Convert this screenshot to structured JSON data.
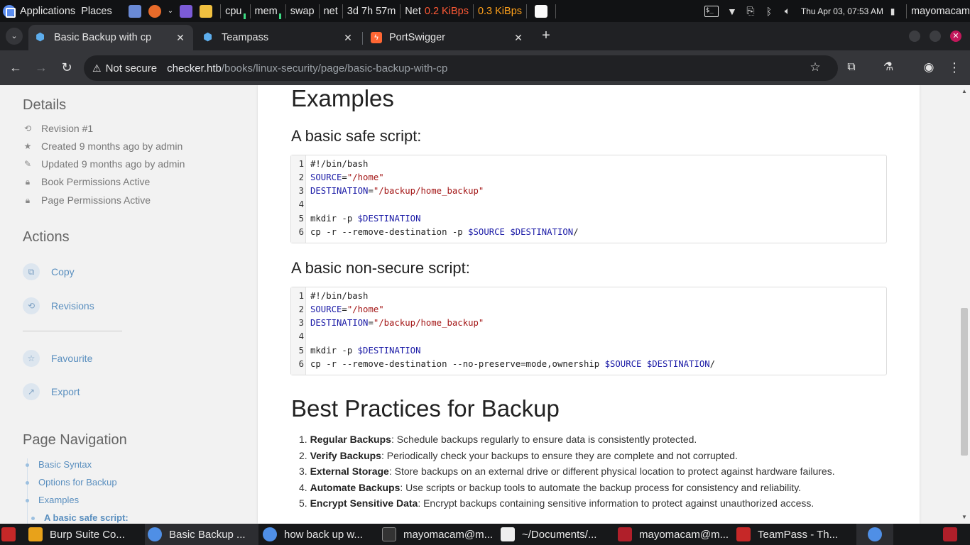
{
  "panel": {
    "applications": "Applications",
    "places": "Places",
    "cpu": "cpu",
    "mem": "mem",
    "swap": "swap",
    "net": "net",
    "uptime": "3d 7h 57m",
    "net_label": "Net",
    "net_down": "0.2 KiBps",
    "net_up": "0.3 KiBps",
    "terminal_icon_text": "$_",
    "datetime": "Thu Apr 03, 07:53 AM",
    "user": "mayomacam"
  },
  "tabs": [
    {
      "title": "Basic Backup with cp",
      "icon": "bookstack-icon"
    },
    {
      "title": "Teampass",
      "icon": "bookstack-icon"
    },
    {
      "title": "PortSwigger",
      "icon": "portswigger-icon"
    }
  ],
  "toolbar": {
    "security": "Not secure",
    "url_host": "checker.htb",
    "url_path": "/books/linux-security/page/basic-backup-with-cp"
  },
  "sidebar": {
    "details_heading": "Details",
    "revision": "Revision #1",
    "created": "Created 9 months ago by admin",
    "updated": "Updated 9 months ago by admin",
    "book_perm": "Book Permissions Active",
    "page_perm": "Page Permissions Active",
    "actions_heading": "Actions",
    "actions": [
      "Copy",
      "Revisions",
      "Favourite",
      "Export"
    ],
    "nav_heading": "Page Navigation",
    "nav_items": [
      "Basic Syntax",
      "Options for Backup",
      "Examples"
    ],
    "nav_sub": "A basic safe script:"
  },
  "page": {
    "examples": "Examples",
    "safe_heading": "A basic safe script:",
    "nonsecure_heading": "A basic non-secure script:",
    "best_heading": "Best Practices for Backup",
    "safe_code": {
      "l1": "#!/bin/bash",
      "l2a": "SOURCE",
      "l2b": "=",
      "l2c": "\"/home\"",
      "l3a": "DESTINATION",
      "l3b": "=",
      "l3c": "\"/backup/home_backup\"",
      "l5a": "mkdir -p ",
      "l5b": "$DESTINATION",
      "l6a": "cp -r --remove-destination -p ",
      "l6b": "$SOURCE",
      "l6c": " ",
      "l6d": "$DESTINATION",
      "l6e": "/"
    },
    "nonsecure_code": {
      "l1": "#!/bin/bash",
      "l2a": "SOURCE",
      "l2b": "=",
      "l2c": "\"/home\"",
      "l3a": "DESTINATION",
      "l3b": "=",
      "l3c": "\"/backup/home_backup\"",
      "l5a": "mkdir -p ",
      "l5b": "$DESTINATION",
      "l6a": "cp -r --remove-destination --no-preserve=mode,ownership ",
      "l6b": "$SOURCE",
      "l6c": " ",
      "l6d": "$DESTINATION",
      "l6e": "/"
    },
    "line_numbers": [
      "1",
      "2",
      "3",
      "4",
      "5",
      "6"
    ],
    "best": [
      {
        "num": "1.",
        "bold": "Regular Backups",
        "text": ": Schedule backups regularly to ensure data is consistently protected."
      },
      {
        "num": "2.",
        "bold": "Verify Backups",
        "text": ": Periodically check your backups to ensure they are complete and not corrupted."
      },
      {
        "num": "3.",
        "bold": "External Storage",
        "text": ": Store backups on an external drive or different physical location to protect against hardware failures."
      },
      {
        "num": "4.",
        "bold": "Automate Backups",
        "text": ": Use scripts or backup tools to automate the backup process for consistency and reliability."
      },
      {
        "num": "5.",
        "bold": "Encrypt Sensitive Data",
        "text": ": Encrypt backups containing sensitive information to protect against unauthorized access."
      }
    ]
  },
  "taskbar": [
    {
      "title": "Burp Suite Co...",
      "icon": "burp-icon",
      "color": "#e8a21a"
    },
    {
      "title": "Basic Backup ...",
      "icon": "chrome-icon",
      "color": "#4f8fe6"
    },
    {
      "title": "how back up w...",
      "icon": "chrome-icon",
      "color": "#4f8fe6"
    },
    {
      "title": "mayomacam@m...",
      "icon": "terminal-icon",
      "color": "#333333"
    },
    {
      "title": "~/Documents/...",
      "icon": "document-icon",
      "color": "#eeeeee"
    },
    {
      "title": "mayomacam@m...",
      "icon": "terminal-red-icon",
      "color": "#b01f2a"
    },
    {
      "title": "TeamPass - Th...",
      "icon": "folder-red-icon",
      "color": "#c62828"
    }
  ],
  "colors": {
    "link": "#5a8fbf",
    "accent_red": "#ff5a36",
    "accent_orange": "#ffa11a",
    "code_var": "#1a1aa6",
    "code_string": "#a31515",
    "code_comment": "#2e7d32"
  }
}
